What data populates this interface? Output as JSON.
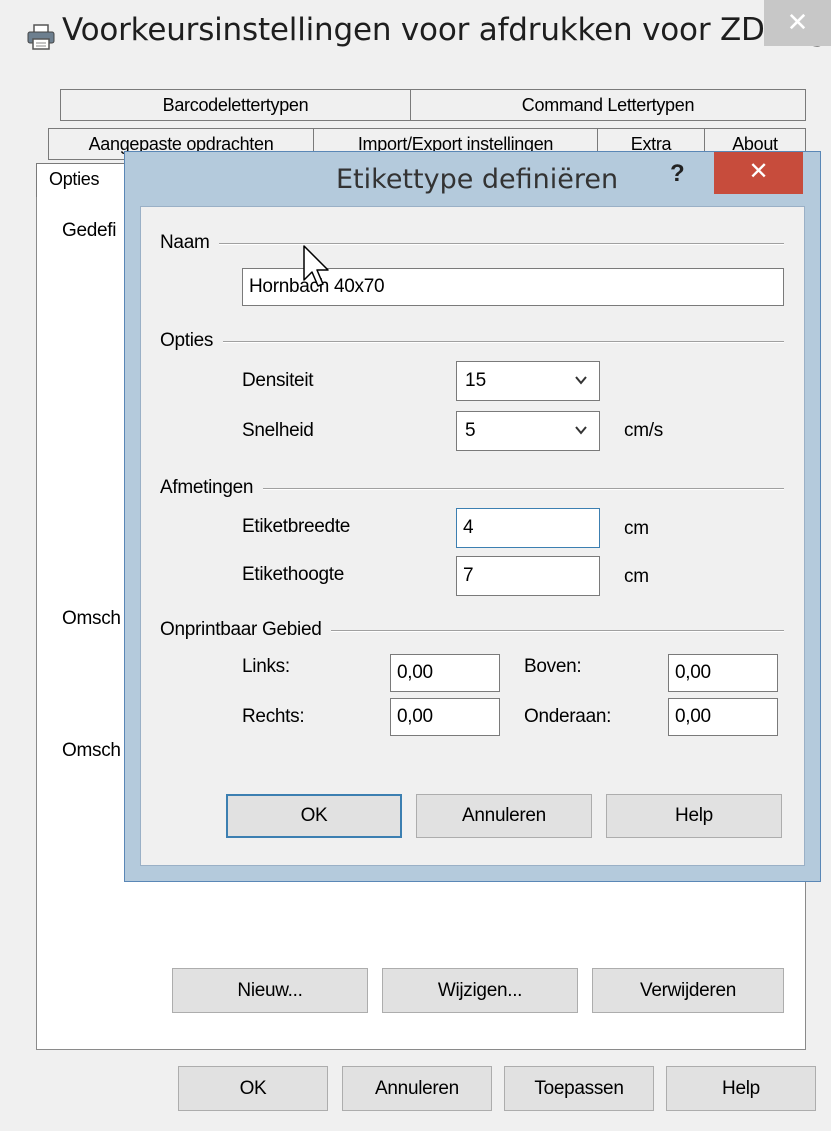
{
  "window": {
    "title": "Voorkeursinstellingen voor afdrukken voor ZDesig...",
    "close": "✕"
  },
  "tabs": {
    "row1": [
      "Barcodelettertypen",
      "Command Lettertypen"
    ],
    "row2": [
      "Aangepaste opdrachten",
      "Import/Export instellingen",
      "Extra",
      "About"
    ],
    "row3": [
      "Opties"
    ]
  },
  "panel": {
    "label_1": "Gedefi",
    "label_2": "Omsch",
    "label_3": "Omsch",
    "buttons": {
      "new": "Nieuw...",
      "edit": "Wijzigen...",
      "delete": "Verwijderen"
    }
  },
  "footer": {
    "ok": "OK",
    "cancel": "Annuleren",
    "apply": "Toepassen",
    "help": "Help"
  },
  "dialog": {
    "title": "Etikettype definiëren",
    "help": "?",
    "close": "✕",
    "name_group": "Naam",
    "name_value": "Hornbach 40x70",
    "options_group": "Opties",
    "density_label": "Densiteit",
    "density_value": "15",
    "speed_label": "Snelheid",
    "speed_value": "5",
    "speed_unit": "cm/s",
    "dimensions_group": "Afmetingen",
    "width_label": "Etiketbreedte",
    "width_value": "4",
    "width_unit": "cm",
    "height_label": "Etikethoogte",
    "height_value": "7",
    "height_unit": "cm",
    "margins_group": "Onprintbaar Gebied",
    "left_label": "Links:",
    "left_value": "0,00",
    "top_label": "Boven:",
    "top_value": "0,00",
    "right_label": "Rechts:",
    "right_value": "0,00",
    "bottom_label": "Onderaan:",
    "bottom_value": "0,00",
    "ok": "OK",
    "cancel": "Annuleren",
    "help_button": "Help"
  },
  "colors": {
    "dialog_frame": "#b4cadc",
    "close_red": "#c74c3c",
    "focus_blue": "#3c7fb1"
  }
}
